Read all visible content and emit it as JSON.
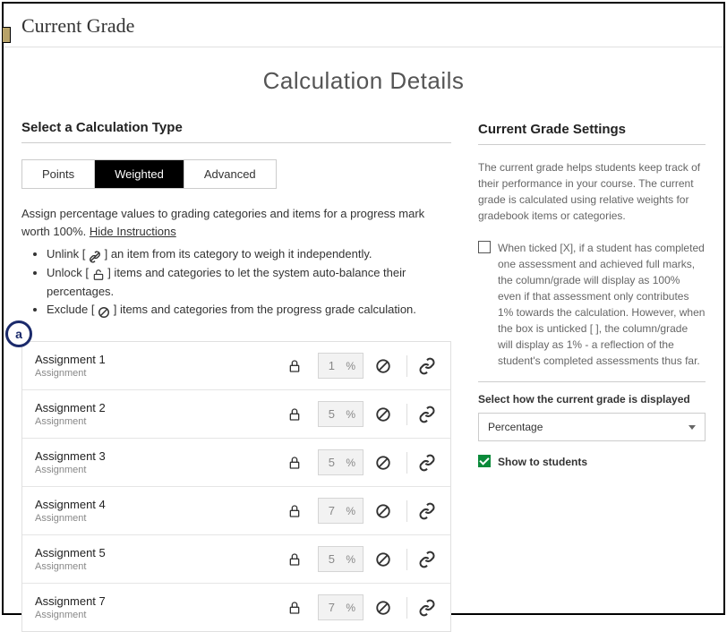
{
  "header": {
    "title": "Current Grade"
  },
  "calc_title": "Calculation Details",
  "left": {
    "section_title": "Select a Calculation Type",
    "tabs": {
      "points": "Points",
      "weighted": "Weighted",
      "advanced": "Advanced"
    },
    "instructions": {
      "lead_a": "Assign percentage values to grading categories and items for a progress mark worth 100%.  ",
      "hide": "Hide Instructions",
      "li1_a": "Unlink [ ",
      "li1_b": " ] an item from its category to weigh it independently.",
      "li2_a": "Unlock [ ",
      "li2_b": " ] items and categories to let the system auto-balance their percentages.",
      "li3_a": "Exclude [ ",
      "li3_b": " ] items and categories from the progress grade calculation."
    },
    "pct_unit": "%",
    "items": [
      {
        "name": "Assignment 1",
        "sub": "Assignment",
        "pct": "1"
      },
      {
        "name": "Assignment 2",
        "sub": "Assignment",
        "pct": "5"
      },
      {
        "name": "Assignment 3",
        "sub": "Assignment",
        "pct": "5"
      },
      {
        "name": "Assignment 4",
        "sub": "Assignment",
        "pct": "7"
      },
      {
        "name": "Assignment 5",
        "sub": "Assignment",
        "pct": "5"
      },
      {
        "name": "Assignment 7",
        "sub": "Assignment",
        "pct": "7"
      }
    ]
  },
  "right": {
    "section_title": "Current Grade Settings",
    "para": "The current grade helps students keep track of their performance in your course. The current grade is calculated using relative weights for gradebook items or categories.",
    "tick_text": "When ticked [X], if a student has completed one assessment and achieved full marks, the column/grade will display as 100% even if that assessment only contributes 1% towards the calculation. However, when the box is unticked [ ], the column/grade will display as 1% - a reflection of the student's completed assessments thus far.",
    "display_label": "Select how the current grade is displayed",
    "display_value": "Percentage",
    "show_label": "Show to students"
  },
  "annotation": "a"
}
